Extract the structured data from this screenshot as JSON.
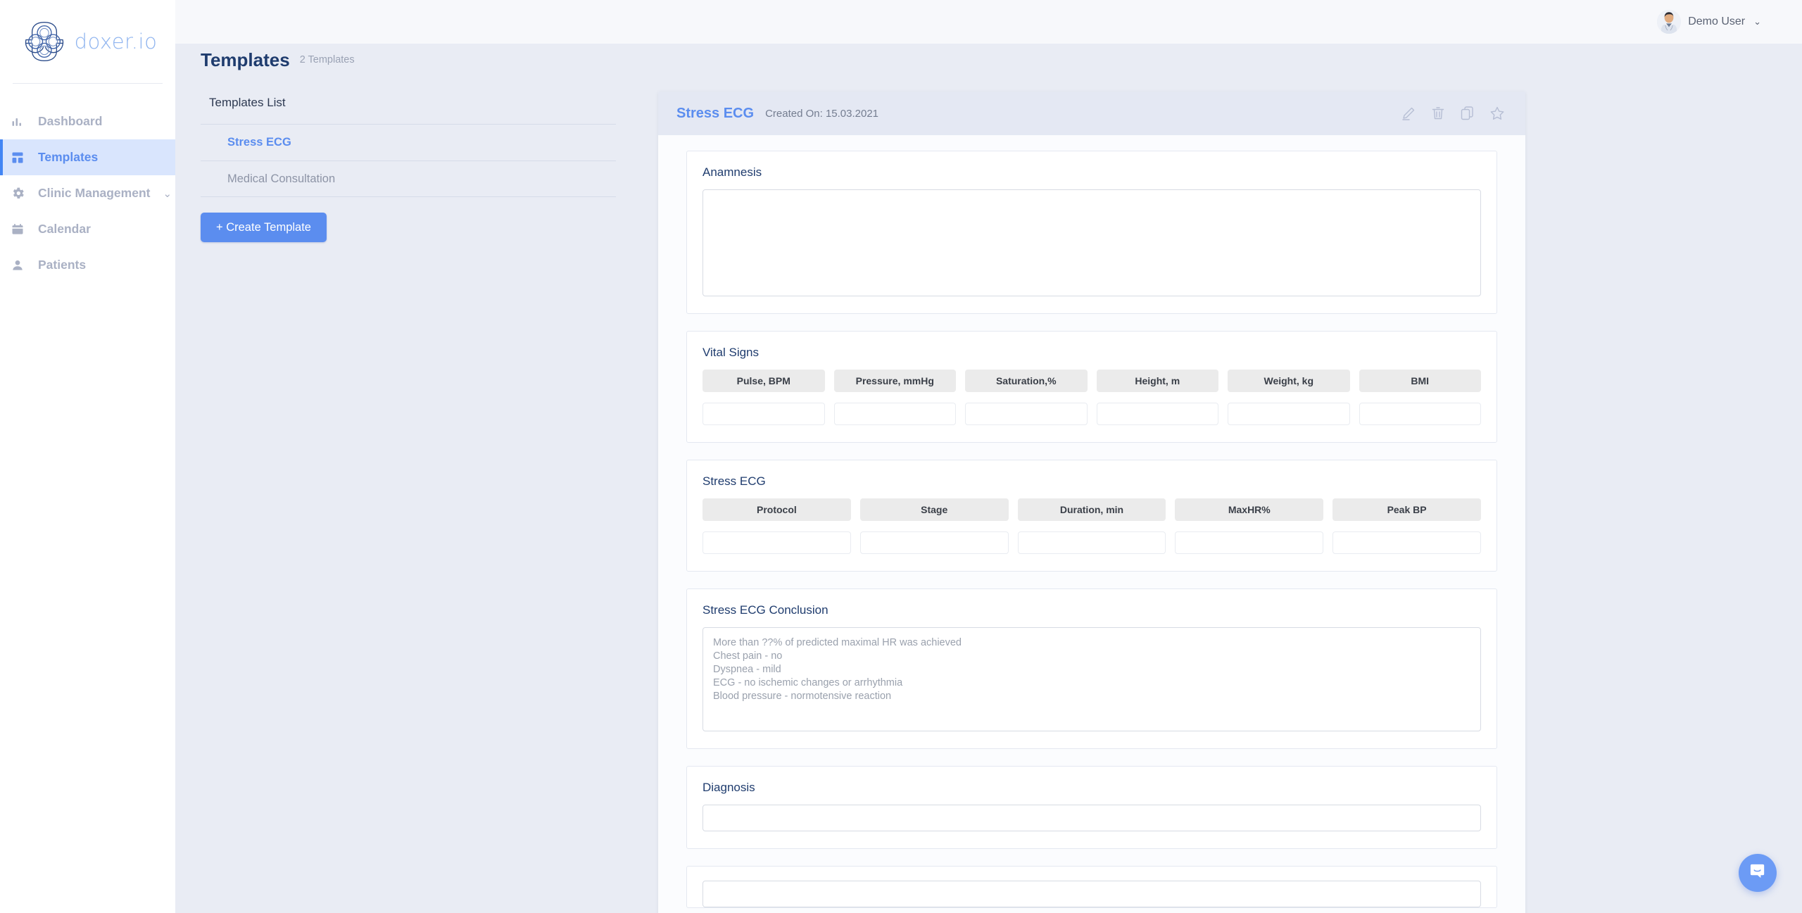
{
  "brand": {
    "name": "doxer.io",
    "logo_icon": "doxer-knot-logo-icon",
    "accent": "#5b8def",
    "logo_dark": "#2f4f8c"
  },
  "sidebar": {
    "items": [
      {
        "label": "Dashboard",
        "icon": "bar-chart-icon",
        "active": false,
        "caret": ""
      },
      {
        "label": "Templates",
        "icon": "grid-layout-icon",
        "active": true,
        "caret": ""
      },
      {
        "label": "Clinic Management",
        "icon": "gear-icon",
        "active": false,
        "caret": "⌄"
      },
      {
        "label": "Calendar",
        "icon": "calendar-icon",
        "active": false,
        "caret": ""
      },
      {
        "label": "Patients",
        "icon": "user-icon",
        "active": false,
        "caret": ""
      }
    ]
  },
  "topbar": {
    "user_name": "Demo User",
    "caret": "⌄",
    "avatar_icon": "doctor-avatar-icon"
  },
  "page": {
    "title": "Templates",
    "subtitle": "2 Templates"
  },
  "templates_panel": {
    "heading": "Templates List",
    "items": [
      {
        "label": "Stress ECG",
        "selected": true
      },
      {
        "label": "Medical Consultation",
        "selected": false
      }
    ],
    "create_button": "+ Create Template"
  },
  "detail": {
    "title": "Stress ECG",
    "created_on": "Created On: 15.03.2021",
    "actions": [
      {
        "name": "edit-icon",
        "title": "Edit"
      },
      {
        "name": "trash-icon",
        "title": "Delete"
      },
      {
        "name": "copy-icon",
        "title": "Duplicate"
      },
      {
        "name": "star-icon",
        "title": "Favorite"
      }
    ],
    "sections": {
      "anamnesis": {
        "title": "Anamnesis",
        "value": ""
      },
      "vital_signs": {
        "title": "Vital Signs",
        "columns": [
          "Pulse, BPM",
          "Pressure, mmHg",
          "Saturation,%",
          "Height, m",
          "Weight, kg",
          "BMI"
        ],
        "values": [
          "",
          "",
          "",
          "",
          "",
          ""
        ]
      },
      "stress_ecg": {
        "title": "Stress ECG",
        "columns": [
          "Protocol",
          "Stage",
          "Duration, min",
          "MaxHR%",
          "Peak  BP"
        ],
        "values": [
          "",
          "",
          "",
          "",
          ""
        ]
      },
      "conclusion": {
        "title": "Stress ECG Conclusion",
        "lines": [
          "More than ??% of predicted maximal HR was achieved",
          "Chest pain - no",
          "Dyspnea - mild",
          "ECG - no ischemic changes or arrhythmia",
          "Blood pressure - normotensive reaction"
        ]
      },
      "diagnosis": {
        "title": "Diagnosis",
        "value": ""
      }
    }
  },
  "chat": {
    "icon": "chat-bubble-icon",
    "color": "#6c9bf5"
  }
}
